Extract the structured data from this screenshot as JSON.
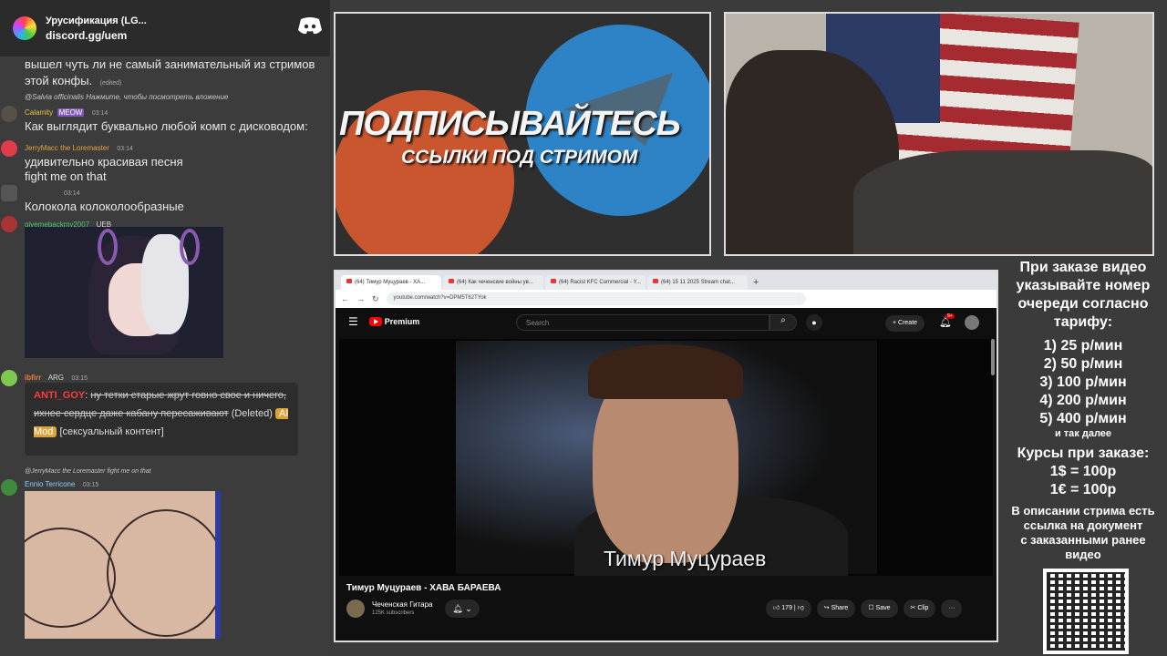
{
  "discord": {
    "server_name": "Урусификация (LG...",
    "invite": "discord.gg/uem",
    "messages": [
      {
        "text": "вышел чуть ли не самый занимательный из стримов этой конфы.",
        "edited": "(edited)"
      },
      {
        "reply": "@Salvia officinalis Нажмите, чтобы посмотреть вложение",
        "user": "Calamity",
        "badge": "MEOW",
        "time": "03:14",
        "text": "Как выглядит буквально любой комп с дисководом:"
      },
      {
        "user": "JerryMacc the Loremaster",
        "time": "03:14",
        "text1": "удивительно красивая песня",
        "text2": "fight me on that"
      },
      {
        "time": "03:14",
        "text": "Колокола колоколообразные"
      },
      {
        "user": "givemebackmy2007",
        "badge": "UEB"
      },
      {
        "user": "ibfirr",
        "badge": "ARG",
        "time": "03:15"
      },
      {
        "reply": "@JerryMacc the Loremaster fight me on that",
        "user": "Ennio Terricone",
        "time": "03:15"
      }
    ],
    "mod": {
      "target": "ANTI_GOY",
      "strike": "ну тетки старые жрут говно свое и ничего, ихнее сердце даже кабану пересаживают",
      "deleted": "(Deleted)",
      "ai": "AI Mod",
      "reason": "[сексуальный контент]"
    }
  },
  "promo": {
    "headline": "ПОДПИСЫВАЙТЕСЬ",
    "sub": "ССЫЛКИ ПОД СТРИМОМ"
  },
  "browser": {
    "tabs": [
      "(64) Тимур Муцураев - ХА...",
      "(64) Как чеченские войны ув...",
      "(64) Racist KFC Commercial - Y...",
      "(64) 15 11 2025 Stream chat..."
    ],
    "new_tab": "+",
    "url": "youtube.com/watch?v=DPM5T62TYok"
  },
  "youtube": {
    "logo": "Premium",
    "search_placeholder": "Search",
    "create": "+ Create",
    "notif_count": "9+",
    "video_caption": "Тимур Муцураев",
    "video_title": "Тимур Муцураев - ХАВА БАРАЕВА",
    "channel": "Чеченская Гитара",
    "subs": "125K subscribers",
    "likes": "179",
    "share": "Share",
    "save": "Save",
    "clip": "Clip",
    "more": "···"
  },
  "info": {
    "line1": "При заказе видео",
    "line2": "указывайте номер",
    "line3": "очереди согласно",
    "line4": "тарифу:",
    "rates": [
      "1) 25 р/мин",
      "2) 50 р/мин",
      "3) 100 р/мин",
      "4) 200 р/мин",
      "5) 400 р/мин"
    ],
    "etc": "и так далее",
    "courses": "Курсы при заказе:",
    "usd": "1$ = 100р",
    "eur": "1€ = 100р",
    "desc1": "В описании стрима есть",
    "desc2": "ссылка на документ",
    "desc3": "с заказанными ранее",
    "desc4": "видео"
  }
}
